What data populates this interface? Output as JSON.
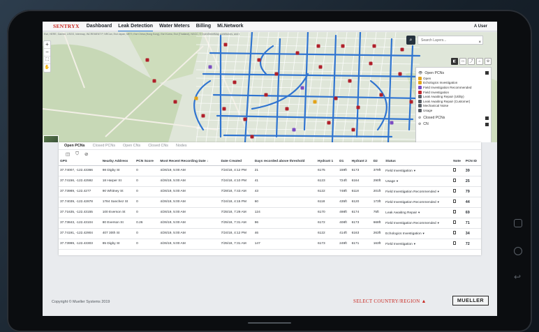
{
  "nav": {
    "brand": "SENTRYX",
    "items": [
      {
        "label": "Dashboard",
        "active": false
      },
      {
        "label": "Leak Detection",
        "active": true
      },
      {
        "label": "Water Meters",
        "active": false
      },
      {
        "label": "Billing",
        "active": false
      },
      {
        "label": "Mi.Network",
        "active": false
      }
    ],
    "user": "A User"
  },
  "map": {
    "attribution": "Esri, HERE, Garmin, USGS, Intermap, INCREMENT P, NRCan, Esri Japan, METI, Esri China (Hong Kong), Esri Korea, Esri (Thailand), NGCC, © OpenStreetMap contributors, and the GIS User Community",
    "zoom_in": "+",
    "zoom_out": "−",
    "search_placeholder": "Search Layers...",
    "close_label": "×",
    "legend": {
      "open_pcns": {
        "label": "Open PCNs",
        "items": [
          {
            "label": "Open",
            "color": "#e3a317"
          },
          {
            "label": "Echologics Investigation",
            "color": "#e3a317"
          },
          {
            "label": "Field Investigation Recommended",
            "color": "#7b4cc2"
          },
          {
            "label": "Field Investigation",
            "color": "#c2262c"
          },
          {
            "label": "Leak Awaiting Repair (Utility)",
            "color": "#5a5f66"
          },
          {
            "label": "Leak Awaiting Repair (Customer)",
            "color": "#5a5f66"
          },
          {
            "label": "Mechanical Noise",
            "color": "#5a5f66"
          },
          {
            "label": "Usage",
            "color": "#5a5f66"
          }
        ]
      },
      "closed_pcns": {
        "label": "Closed PCNs"
      },
      "cn": {
        "label": "CN"
      }
    }
  },
  "panel": {
    "tabs": [
      {
        "label": "Open PCNs",
        "active": true
      },
      {
        "label": "Closed PCNs",
        "active": false
      },
      {
        "label": "Open CNs",
        "active": false
      },
      {
        "label": "Closed CNs",
        "active": false
      },
      {
        "label": "Nodes",
        "active": false
      }
    ],
    "columns": [
      "GPS",
      "Nearby Address",
      "PCN Score",
      "Most Recent Recording Date ↓",
      "Date Created",
      "Days recorded above threshold",
      "Hydrant 1",
      "D1",
      "Hydrant 2",
      "D2",
      "Status",
      "Note",
      "PCN ID"
    ],
    "rows": [
      {
        "gps": "37.74007, -122.43366",
        "address": "98 Digby St",
        "score": "0",
        "recent": "4/26/19, 5:00 AM",
        "created": "7/24/18, 4:12 PM",
        "days": "21",
        "h1": "6175",
        "d1": "159ft",
        "h2": "6173",
        "d2": "379ft",
        "status": "Field Investigation",
        "id": "39"
      },
      {
        "gps": "37.74156, -122.42592",
        "address": "18 Harper St",
        "score": "0",
        "recent": "4/26/19, 5:00 AM",
        "created": "7/24/18, 4:10 PM",
        "days": "41",
        "h1": "6123",
        "d1": "724ft",
        "h2": "6164",
        "d2": "290ft",
        "status": "Usage",
        "id": "25"
      },
      {
        "gps": "37.73989, -122.4277",
        "address": "90 Whitney St",
        "score": "0",
        "recent": "4/26/19, 5:00 AM",
        "created": "7/29/18, 7:43 AM",
        "days": "43",
        "h1": "6122",
        "d1": "748ft",
        "h2": "6118",
        "d2": "201ft",
        "status": "Field Investigation Recommended",
        "id": "79"
      },
      {
        "gps": "37.74039, -122.42878",
        "address": "1784 Sanchez St",
        "score": "0",
        "recent": "4/26/19, 5:00 AM",
        "created": "7/24/18, 4:15 PM",
        "days": "60",
        "h1": "6118",
        "d1": "435ft",
        "h2": "6120",
        "d2": "173ft",
        "status": "Field Investigation Recommended",
        "id": "44"
      },
      {
        "gps": "37.71635, -122.43155",
        "address": "100 Everson St",
        "score": "0",
        "recent": "4/26/19, 5:00 AM",
        "created": "7/25/18, 7:29 AM",
        "days": "124",
        "h1": "6170",
        "d1": "498ft",
        "h2": "6174",
        "d2": "75ft",
        "status": "Leak Awaiting Repair",
        "id": "69"
      },
      {
        "gps": "37.73843, -122.43104",
        "address": "80 Everson St",
        "score": "0.26",
        "recent": "4/26/19, 5:00 AM",
        "created": "7/25/18, 7:31 AM",
        "days": "96",
        "h1": "6172",
        "d1": "408ft",
        "h2": "6173",
        "d2": "668ft",
        "status": "Field Investigation Recommended",
        "id": "71"
      },
      {
        "gps": "37.74191, -122.42904",
        "address": "407 30th St",
        "score": "0",
        "recent": "4/26/19, 5:00 AM",
        "created": "7/24/18, 4:12 PM",
        "days": "46",
        "h1": "6122",
        "d1": "414ft",
        "h2": "6163",
        "d2": "263ft",
        "status": "Echologics Investigation",
        "id": "34"
      },
      {
        "gps": "37.73999, -122.43303",
        "address": "85 Digby St",
        "score": "0",
        "recent": "4/26/19, 5:00 AM",
        "created": "7/25/18, 7:31 AM",
        "days": "147",
        "h1": "6173",
        "d1": "249ft",
        "h2": "6171",
        "d2": "163ft",
        "status": "Field Investigation",
        "id": "72"
      }
    ]
  },
  "footer": {
    "copyright": "Copyright © Mueller Systems 2019",
    "country": "SELECT COUNTRY/REGION ▲",
    "logo": "MUELLER"
  },
  "colors": {
    "brand_red": "#c8261f",
    "accent_blue": "#1a6fc0",
    "pipe_blue": "#2f74d0",
    "marker_red": "#b01f2a"
  }
}
